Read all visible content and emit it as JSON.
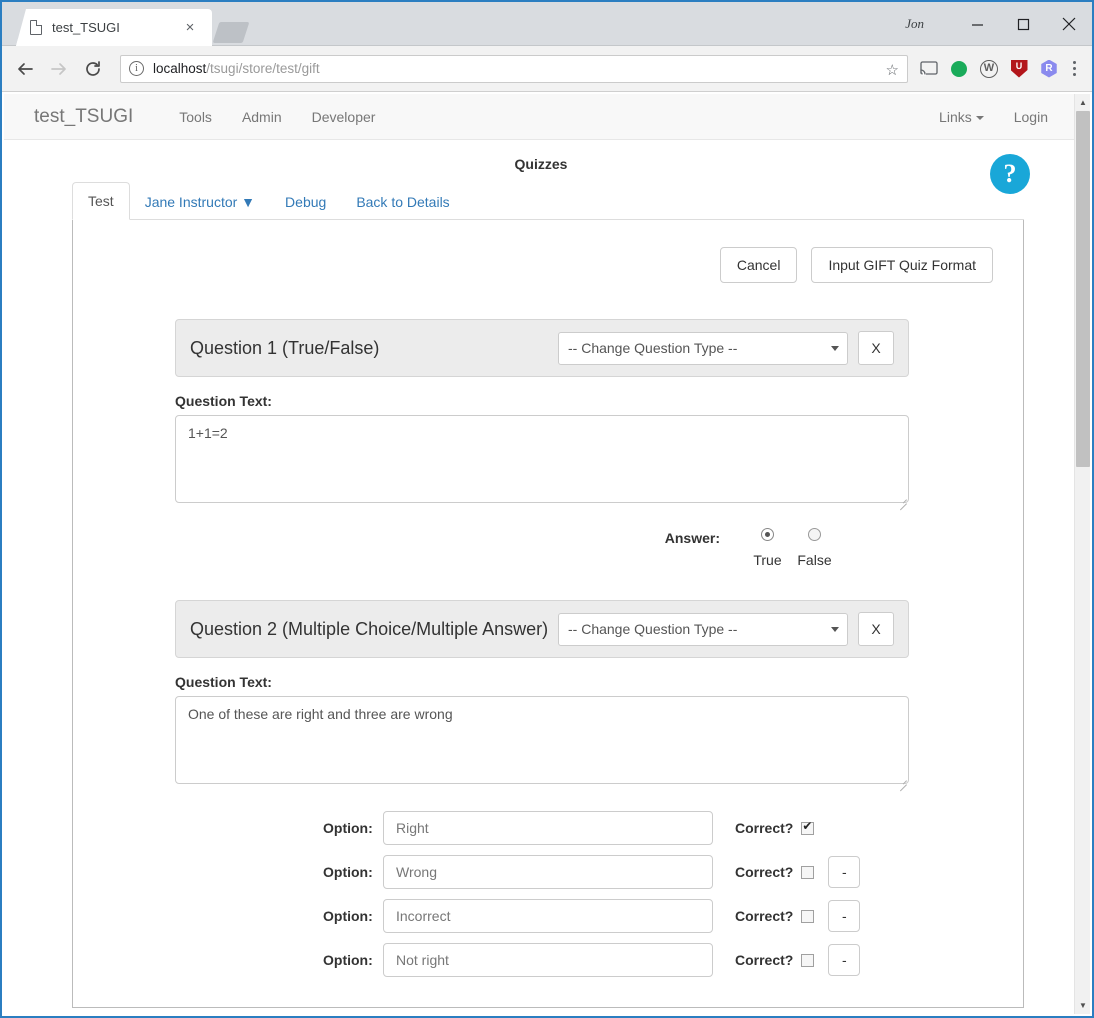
{
  "browser": {
    "tab": {
      "title": "test_TSUGI",
      "close_label": "×",
      "icon": "page-icon"
    },
    "new_tab_label": "",
    "window": {
      "profile_label": "Jon",
      "minimize": "−",
      "maximize": "□",
      "close": "✕"
    },
    "toolbar": {
      "back": "←",
      "forward": "→",
      "reload": "⟳",
      "url_secure_part": "localhost",
      "url_path_part": "/tsugi/store/test/gift",
      "url_full": "localhost/tsugi/store/test/gift",
      "bookmark": "☆",
      "cast": "cast-icon",
      "extensions": [
        {
          "name": "green-dot-extension",
          "glyph": ""
        },
        {
          "name": "w-circle-extension",
          "glyph": "W"
        },
        {
          "name": "red-shield-extension",
          "glyph": "U"
        },
        {
          "name": "purple-hex-extension",
          "glyph": "R"
        }
      ],
      "menu": "⋮"
    }
  },
  "navbar": {
    "brand": "test_TSUGI",
    "left_items": [
      {
        "label": "Tools"
      },
      {
        "label": "Admin"
      },
      {
        "label": "Developer"
      }
    ],
    "right_items": [
      {
        "label": "Links",
        "has_caret": true
      },
      {
        "label": "Login",
        "has_caret": false
      }
    ]
  },
  "page": {
    "title": "Quizzes",
    "help_badge": "?",
    "tabs": [
      {
        "label": "Test",
        "active": true
      },
      {
        "label": "Jane Instructor ▼",
        "active": false
      },
      {
        "label": "Debug",
        "active": false
      },
      {
        "label": "Back to Details",
        "active": false
      }
    ],
    "actions": {
      "cancel_label": "Cancel",
      "gift_label": "Input GIFT Quiz Format"
    },
    "question_text_label": "Question Text:",
    "change_type_placeholder": "-- Change Question Type --",
    "remove_question_label": "X",
    "questions": [
      {
        "heading": "Question 1 (True/False)",
        "type": "truefalse",
        "text": "1+1=2",
        "answer_label": "Answer:",
        "choices": [
          {
            "label": "True",
            "selected": true
          },
          {
            "label": "False",
            "selected": false
          }
        ]
      },
      {
        "heading": "Question 2 (Multiple Choice/Multiple Answer)",
        "type": "multiplechoice",
        "text": "One of these are right and three are wrong",
        "option_label": "Option:",
        "correct_label": "Correct?",
        "remove_option_label": "-",
        "options": [
          {
            "value": "Right",
            "correct": true,
            "removable": false
          },
          {
            "value": "Wrong",
            "correct": false,
            "removable": true
          },
          {
            "value": "Incorrect",
            "correct": false,
            "removable": true
          },
          {
            "value": "Not right",
            "correct": false,
            "removable": true
          }
        ]
      }
    ]
  },
  "colors": {
    "accent": "#337ab7",
    "help_badge": "#19a7d8",
    "panel_header": "#ececec",
    "window_border": "#2b7ec1"
  }
}
